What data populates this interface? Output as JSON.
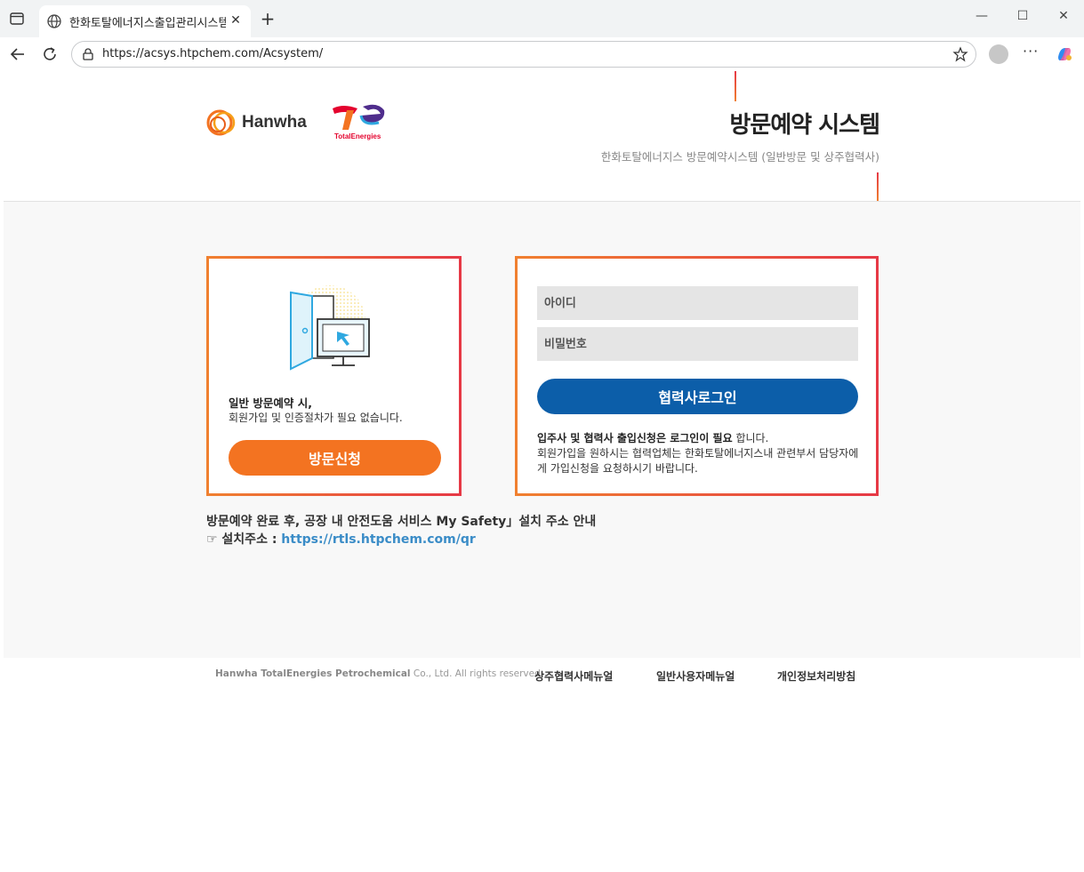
{
  "browser": {
    "tab_title": "한화토탈에너지스출입관리시스템",
    "url": "https://acsys.htpchem.com/Acsystem/"
  },
  "header": {
    "logo_hanwha": "Hanwha",
    "logo_te": "TotalEnergies",
    "title": "방문예약 시스템",
    "subtitle": "한화토탈에너지스 방문예약시스템 (일반방문 및 상주협력사)"
  },
  "visit_card": {
    "line1": "일반 방문예약 시,",
    "line2": "회원가입 및 인증절차가 필요 없습니다.",
    "button": "방문신청"
  },
  "login_card": {
    "id_placeholder": "아이디",
    "pw_placeholder": "비밀번호",
    "button": "협력사로그인",
    "notice_bold": "입주사 및 협력사 출입신청은 로그인이 필요",
    "notice_tail": " 합니다.",
    "notice_body": "회원가입을 원하시는 협력업체는 한화토탈에너지스내 관련부서 담당자에게 가입신청을 요청하시기 바랍니다."
  },
  "info": {
    "line1": "방문예약 완료 후, 공장 내 안전도움 서비스 My Safety」설치 주소 안내",
    "line2_prefix": "☞ 설치주소 : ",
    "link": "https://rtls.htpchem.com/qr"
  },
  "footer": {
    "company": "Hanwha TotalEnergies Petrochemical",
    "rights": " Co., Ltd. All rights reserved.",
    "links": [
      "상주협력사메뉴얼",
      "일반사용자메뉴얼",
      "개인정보처리방침"
    ]
  }
}
